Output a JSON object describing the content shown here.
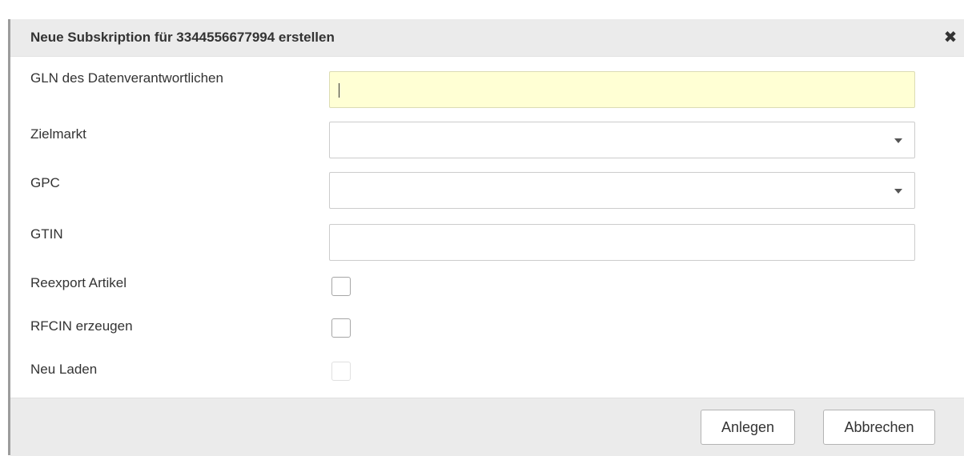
{
  "dialog": {
    "title": "Neue Subskription für 3344556677994 erstellen",
    "close_icon": "close-icon"
  },
  "form": {
    "gln": {
      "label": "GLN des Datenverantwortlichen",
      "value": ""
    },
    "zielmarkt": {
      "label": "Zielmarkt",
      "value": ""
    },
    "gpc": {
      "label": "GPC",
      "value": ""
    },
    "gtin": {
      "label": "GTIN",
      "value": ""
    },
    "reexport": {
      "label": "Reexport Artikel",
      "checked": false
    },
    "rfcin": {
      "label": "RFCIN erzeugen",
      "checked": false
    },
    "neu_laden": {
      "label": "Neu Laden",
      "checked": false,
      "disabled": true
    }
  },
  "footer": {
    "create_label": "Anlegen",
    "cancel_label": "Abbrechen"
  },
  "colors": {
    "titlebar": "#ebebeb",
    "focused_input": "#ffffd4",
    "text": "#333333"
  }
}
